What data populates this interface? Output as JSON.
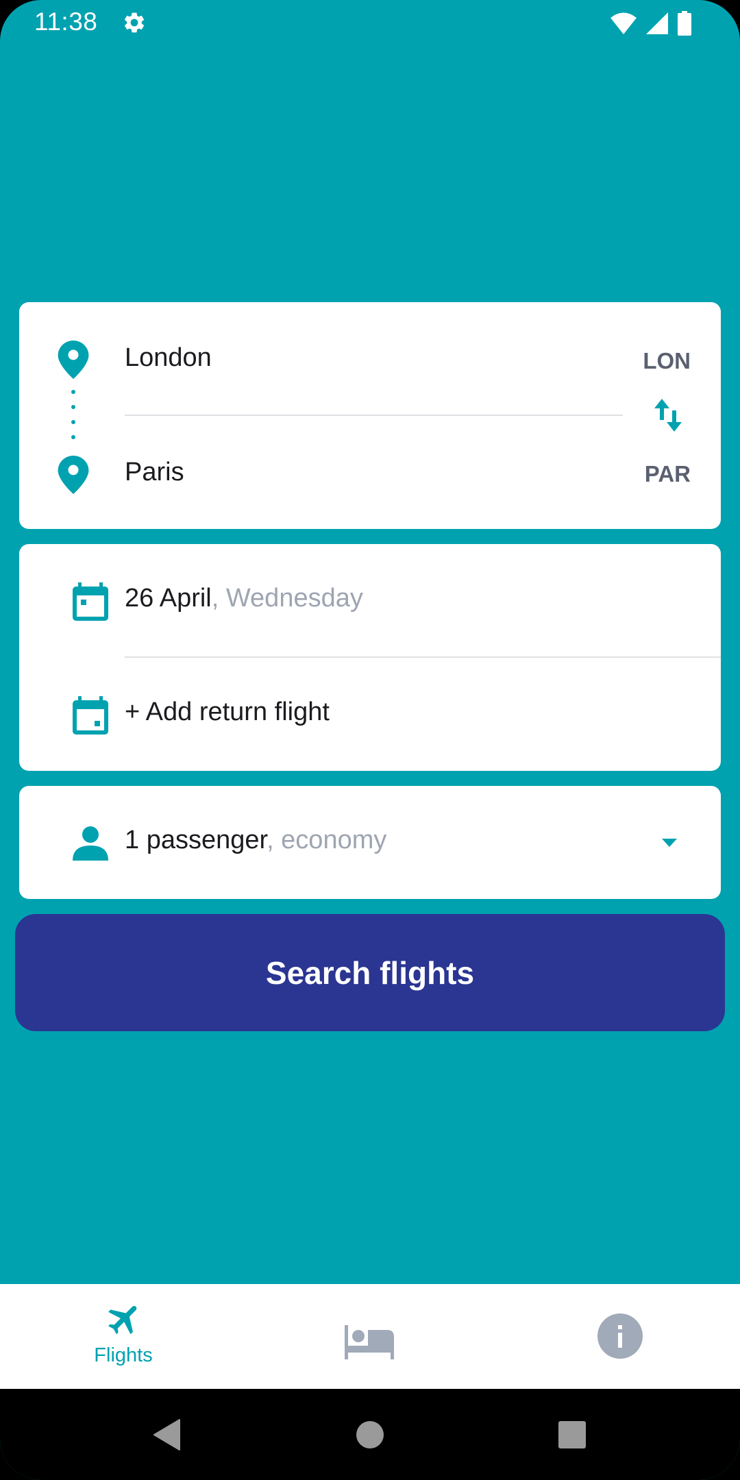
{
  "status_bar": {
    "time": "11:38",
    "icons": [
      "settings-gear-icon",
      "wifi-icon",
      "cellular-signal-icon",
      "battery-icon"
    ]
  },
  "route": {
    "origin": {
      "city": "London",
      "code": "LON"
    },
    "destination": {
      "city": "Paris",
      "code": "PAR"
    },
    "swap_icon": "swap-vertical-icon"
  },
  "dates": {
    "departure": {
      "date": "26 April",
      "weekday": ", Wednesday"
    },
    "return_label": "+ Add return flight"
  },
  "passengers": {
    "count_label": "1 passenger",
    "class_label": ", economy"
  },
  "search_button": {
    "label": "Search flights"
  },
  "bottom_nav": {
    "items": [
      {
        "id": "flights",
        "label": "Flights",
        "icon": "airplane-icon",
        "active": true
      },
      {
        "id": "hotels",
        "label": "",
        "icon": "bed-icon",
        "active": false
      },
      {
        "id": "info",
        "label": "",
        "icon": "info-icon",
        "active": false
      }
    ]
  },
  "colors": {
    "primary": "#00A2B0",
    "button": "#2B3592",
    "muted_text": "#9ea5b1",
    "inactive_icon": "#a0aab8"
  }
}
